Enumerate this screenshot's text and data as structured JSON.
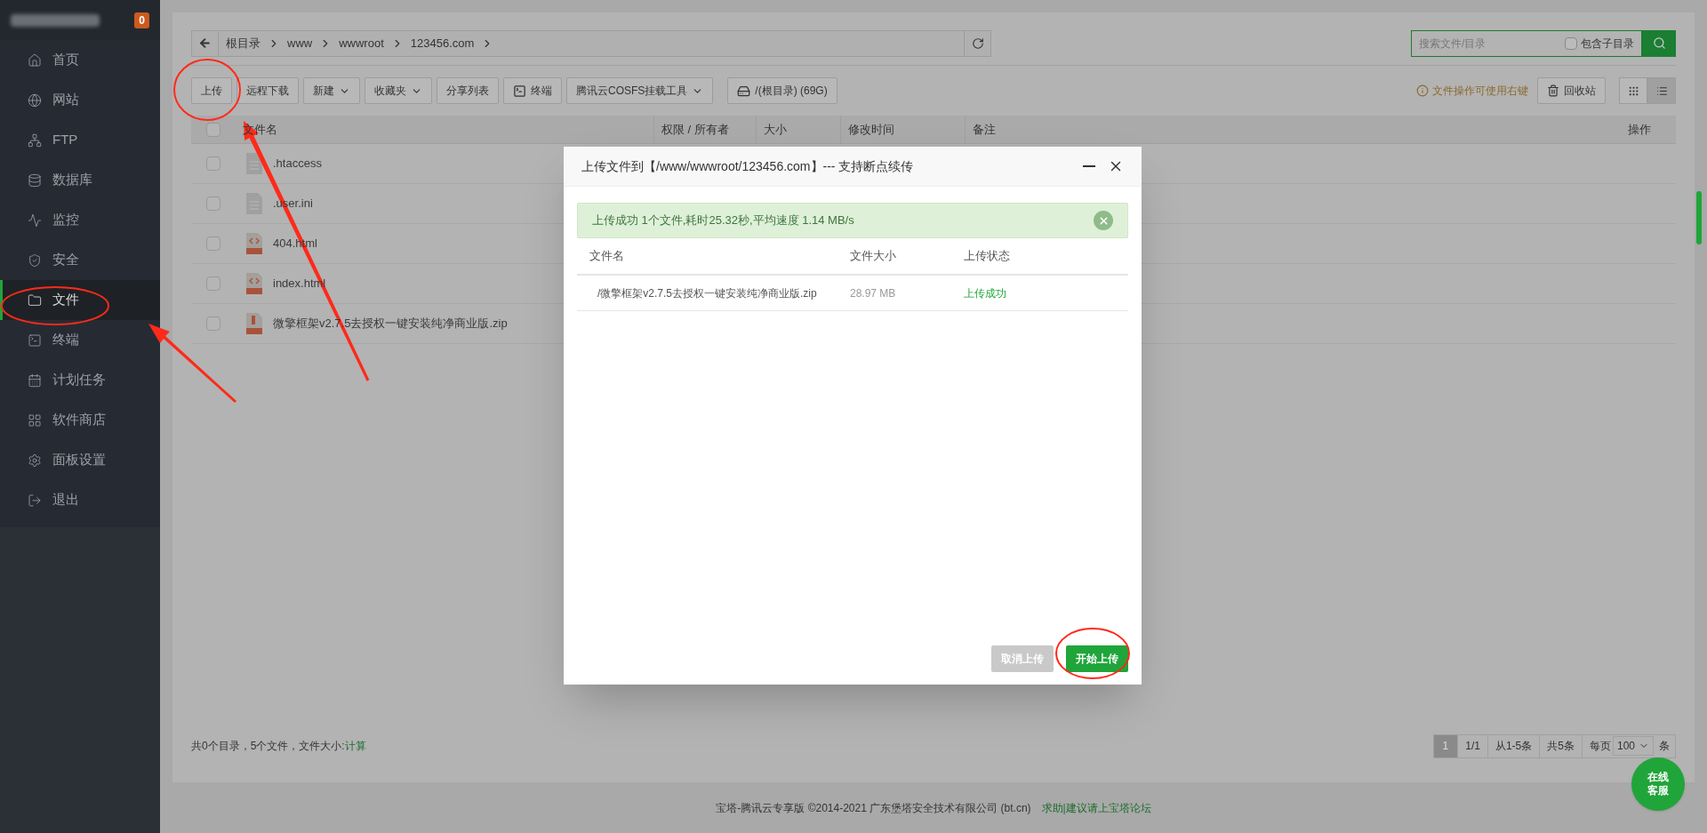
{
  "sidebar": {
    "badge": "0",
    "items": [
      {
        "label": "首页",
        "selected": false
      },
      {
        "label": "网站",
        "selected": false
      },
      {
        "label": "FTP",
        "selected": false
      },
      {
        "label": "数据库",
        "selected": false
      },
      {
        "label": "监控",
        "selected": false
      },
      {
        "label": "安全",
        "selected": false
      },
      {
        "label": "文件",
        "selected": true
      },
      {
        "label": "终端",
        "selected": false
      },
      {
        "label": "计划任务",
        "selected": false
      },
      {
        "label": "软件商店",
        "selected": false
      },
      {
        "label": "面板设置",
        "selected": false
      },
      {
        "label": "退出",
        "selected": false
      }
    ]
  },
  "breadcrumb": [
    "根目录",
    "www",
    "wwwroot",
    "123456.com"
  ],
  "search": {
    "placeholder": "搜索文件/目录",
    "subdir_label": "包含子目录",
    "subdir_checked": false
  },
  "toolbar": [
    {
      "label": "上传",
      "caret": false
    },
    {
      "label": "远程下载",
      "caret": false
    },
    {
      "label": "新建",
      "caret": true
    },
    {
      "label": "收藏夹",
      "caret": true
    },
    {
      "label": "分享列表",
      "caret": false
    },
    {
      "label": "终端",
      "caret": false
    },
    {
      "label": "腾讯云COSFS挂载工具",
      "caret": true
    },
    {
      "label": "/(根目录) (69G)",
      "caret": false
    }
  ],
  "hint": "文件操作可使用右键",
  "recycle": "回收站",
  "view_modes": [
    {
      "selected": false
    },
    {
      "selected": true
    }
  ],
  "table": {
    "all_checked": false,
    "columns": [
      "文件名",
      "权限 / 所有者",
      "大小",
      "修改时间",
      "备注",
      "操作"
    ],
    "rows": [
      {
        "name": ".htaccess",
        "kind": "doc",
        "checked": false
      },
      {
        "name": ".user.ini",
        "kind": "doc",
        "checked": false
      },
      {
        "name": "404.html",
        "kind": "html",
        "checked": false
      },
      {
        "name": "index.html",
        "kind": "html",
        "checked": false
      },
      {
        "name": "微擎框架v2.7.5去授权一键安装纯净商业版.zip",
        "kind": "zip",
        "checked": false
      }
    ]
  },
  "summary": {
    "text": "共0个目录，5个文件，文件大小:",
    "link": "计算"
  },
  "pagination": {
    "pages": [
      {
        "label": "1",
        "selected": true
      }
    ],
    "items": [
      "1/1",
      "从1-5条",
      "共5条"
    ],
    "per_page_label": "每页",
    "per_page": "100",
    "unit": "条"
  },
  "footer": {
    "text": "宝塔-腾讯云专享版 ©2014-2021 广东堡塔安全技术有限公司 (bt.cn)",
    "link": "求助|建议请上宝塔论坛"
  },
  "chat_button": [
    "在线",
    "客服"
  ],
  "dialog": {
    "title": "上传文件到【/www/wwwroot/123456.com】--- 支持断点续传",
    "alert": "上传成功 1个文件,耗时25.32秒,平均速度 1.14 MB/s",
    "columns": [
      "文件名",
      "文件大小",
      "上传状态"
    ],
    "files": [
      {
        "name": "/微擎框架v2.7.5去授权一键安装纯净商业版.zip",
        "size": "28.97 MB",
        "status": "上传成功",
        "done": true
      }
    ],
    "cancel": "取消上传",
    "start": "开始上传"
  }
}
